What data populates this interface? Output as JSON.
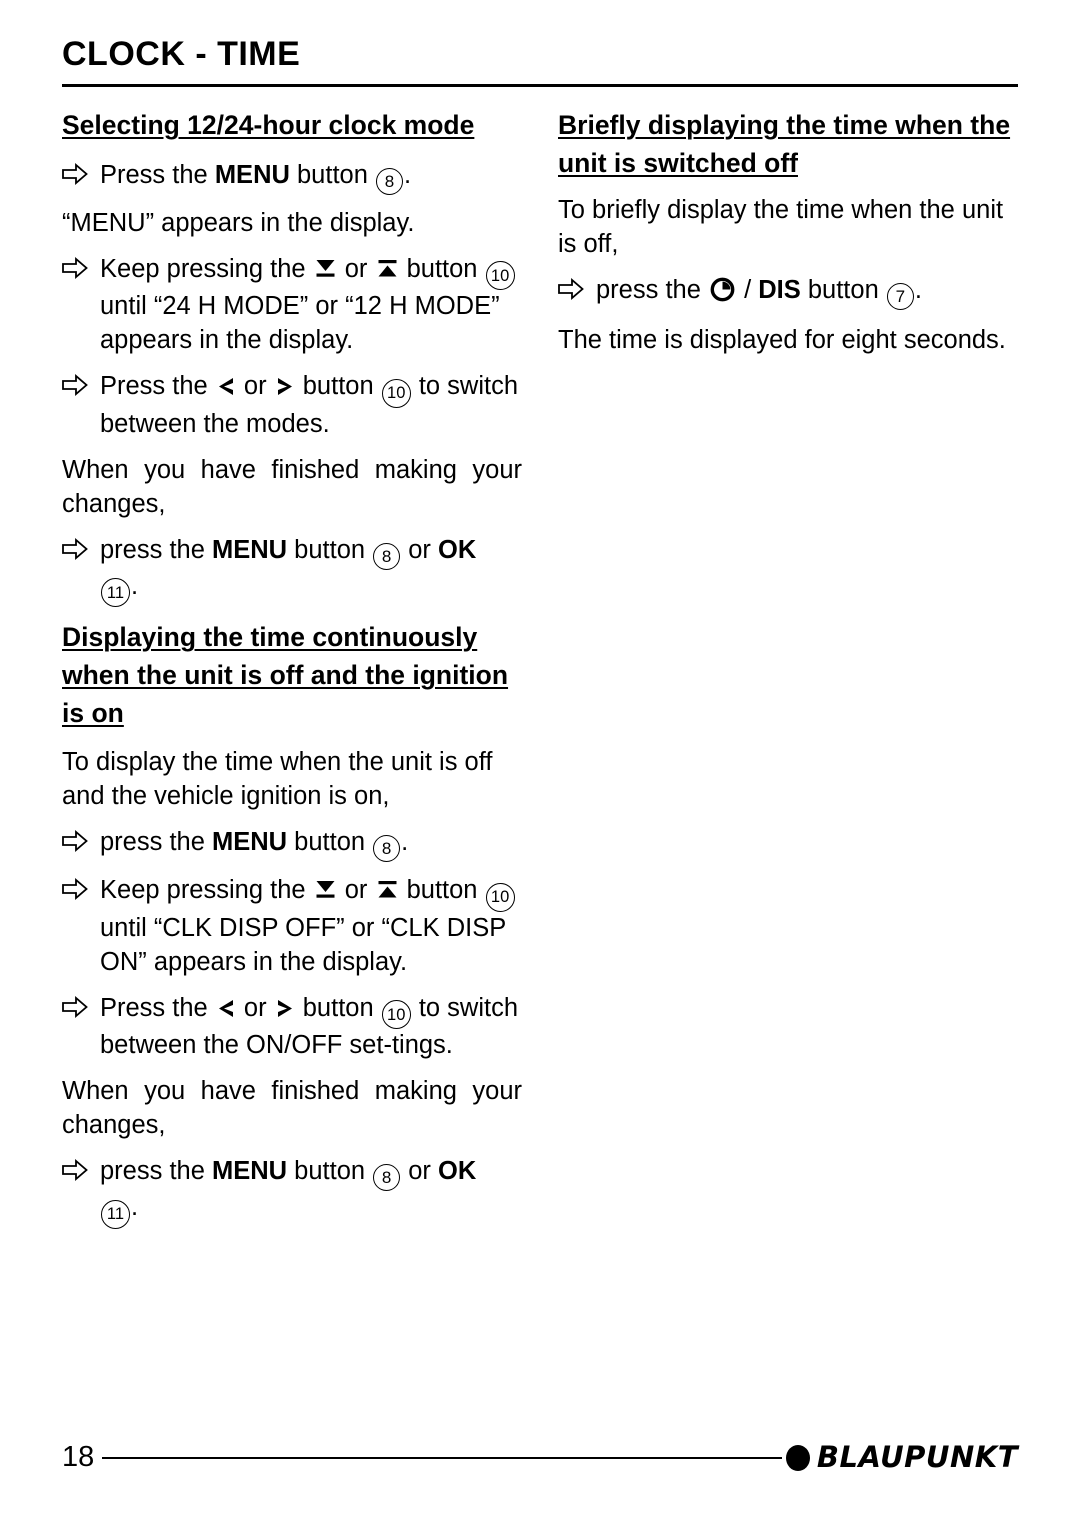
{
  "document": {
    "title": "CLOCK - TIME",
    "page_number": "18",
    "brand": "BLAUPUNKT"
  },
  "left_column": {
    "section1": {
      "heading": "Selecting 12/24-hour clock mode",
      "steps": [
        {
          "bullet": "white-right-arrow",
          "text_before": "Press the ",
          "bold": "MENU",
          "text_mid": " button ",
          "ref": "8",
          "text_after": "."
        }
      ],
      "note1": "“MENU” appears in the display.",
      "step2": {
        "bullet": "white-right-arrow",
        "text_before": "Keep pressing the ",
        "icon1": "seek-down-icon",
        "text_mid1": " or ",
        "icon2": "seek-up-icon",
        "text_mid2": " button ",
        "ref": "10",
        "text_after": " until “24 H MODE” or “12 H MODE” appears in the display."
      },
      "step3": {
        "bullet": "white-right-arrow",
        "text_before": "Press the ",
        "icon1": "chevron-left-icon",
        "text_mid1": " or ",
        "icon2": "chevron-right-icon",
        "text_mid2": " button ",
        "ref": "10",
        "text_after": " to switch between the modes."
      },
      "note2": "When you have finished making your changes,",
      "step4": {
        "bullet": "white-right-arrow",
        "text_before": "press the ",
        "bold1": "MENU",
        "text_mid1": " button ",
        "ref1": "8",
        "text_mid2": " or ",
        "bold2": "OK",
        "text_mid3": " ",
        "ref2": "11",
        "text_after": "."
      }
    },
    "section2": {
      "heading": "Displaying the time continuously when the unit is off and the ignition is on",
      "note1": "To display the time when the unit is off and the vehicle ignition is on,",
      "step1": {
        "bullet": "white-right-arrow",
        "text_before": "press the ",
        "bold": "MENU",
        "text_mid": " button ",
        "ref": "8",
        "text_after": "."
      },
      "step2": {
        "bullet": "white-right-arrow",
        "text_before": "Keep pressing the ",
        "icon1": "seek-down-icon",
        "text_mid1": " or ",
        "icon2": "seek-up-icon",
        "text_mid2": " button ",
        "ref": "10",
        "text_after": " until “CLK DISP OFF” or “CLK DISP ON” appears in the display."
      },
      "step3": {
        "bullet": "white-right-arrow",
        "text_before": "Press the ",
        "icon1": "chevron-left-icon",
        "text_mid1": " or ",
        "icon2": "chevron-right-icon",
        "text_mid2": " button ",
        "ref": "10",
        "text_after": " to switch between the ON/OFF set-tings."
      },
      "note2": "When you have finished making your changes,",
      "step4": {
        "bullet": "white-right-arrow",
        "text_before": "press the ",
        "bold1": "MENU",
        "text_mid1": " button ",
        "ref1": "8",
        "text_mid2": " or ",
        "bold2": "OK",
        "text_mid3": " ",
        "ref2": "11",
        "text_after": "."
      }
    }
  },
  "right_column": {
    "section1": {
      "heading": "Briefly displaying the time when the unit is switched off",
      "note1": "To briefly display the time when the unit is off,",
      "step1": {
        "bullet": "white-right-arrow",
        "text_before": "press the ",
        "icon": "clock-icon",
        "text_mid1": " / ",
        "bold": "DIS",
        "text_mid2": " button ",
        "ref": "7",
        "text_after": "."
      },
      "note2": "The time is displayed for eight seconds."
    }
  }
}
